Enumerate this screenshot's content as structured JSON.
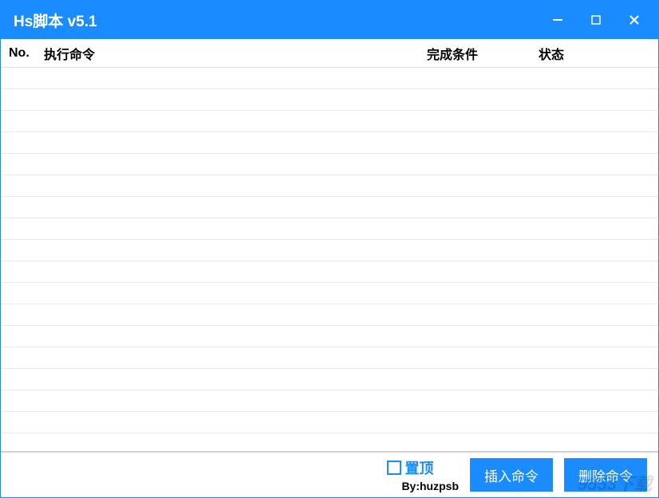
{
  "window": {
    "title": "Hs脚本 v5.1"
  },
  "table": {
    "headers": {
      "no": "No.",
      "command": "执行命令",
      "condition": "完成条件",
      "status": "状态"
    }
  },
  "footer": {
    "pin_label": "置顶",
    "byline": "By:huzpsb",
    "insert_label": "插入命令",
    "delete_label": "删除命令"
  },
  "watermark": "9553下载"
}
